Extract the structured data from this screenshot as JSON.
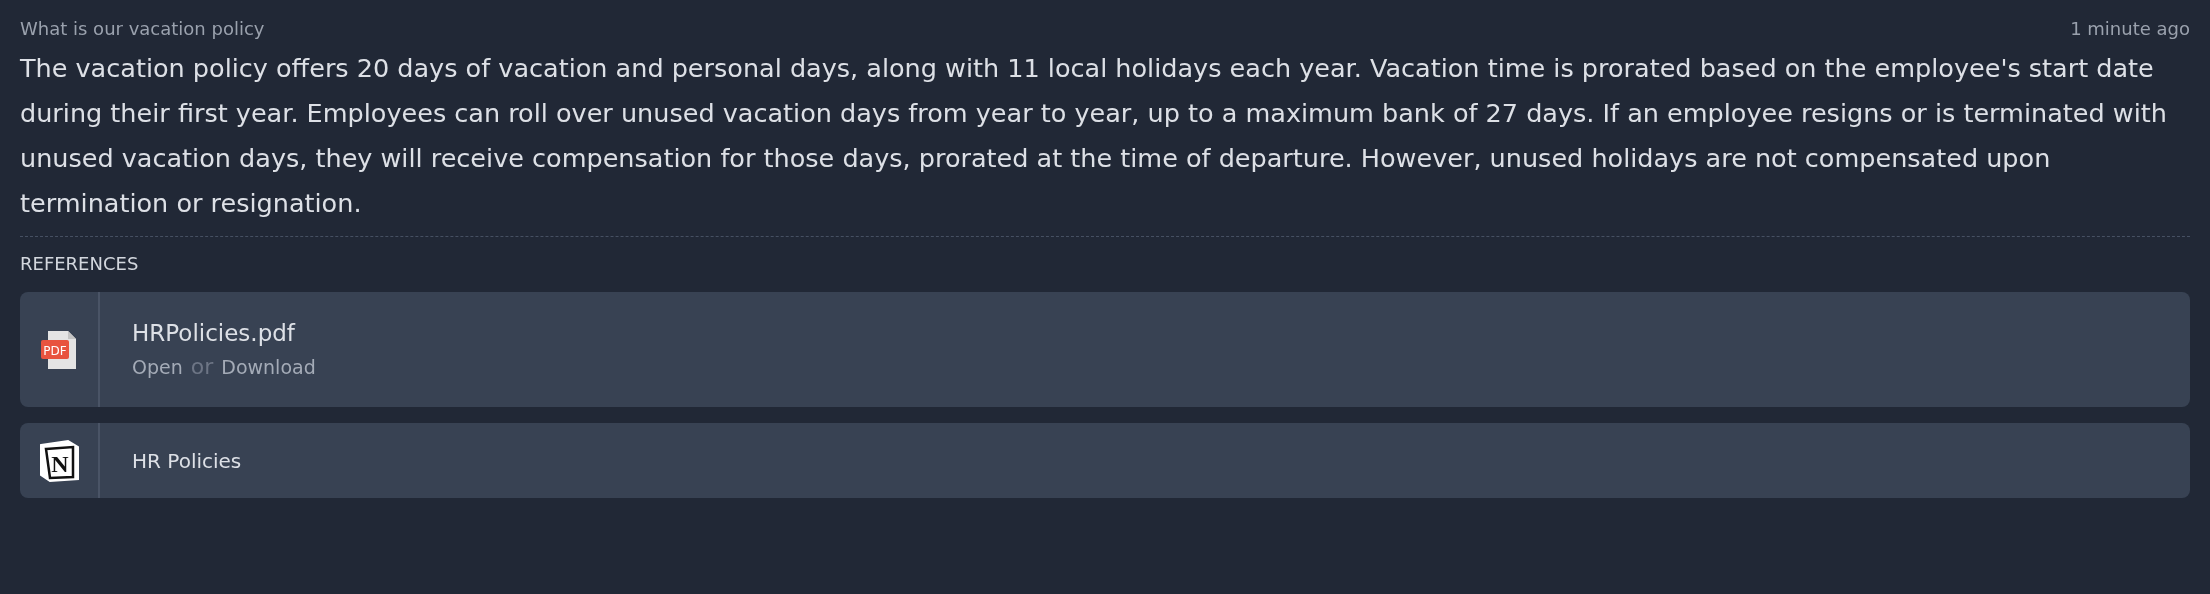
{
  "question": "What is our vacation policy",
  "time": "1 minute ago",
  "answer": "The vacation policy offers 20 days of vacation and personal days, along with 11 local holidays each year. Vacation time is prorated based on the employee's start date during their first year. Employees can roll over unused vacation days from year to year, up to a maximum bank of 27 days. If an employee resigns or is terminated with unused vacation days, they will receive compensation for those days, prorated at the time of departure. However, unused holidays are not compensated upon termination or resignation.",
  "references_heading": "REFERENCES",
  "references": [
    {
      "kind": "pdf",
      "icon_text": "PDF",
      "title": "HRPolicies.pdf",
      "actions": [
        "Open",
        "Download"
      ],
      "separator": "or"
    },
    {
      "kind": "page",
      "icon_text": "N",
      "title": "HR Policies"
    }
  ]
}
